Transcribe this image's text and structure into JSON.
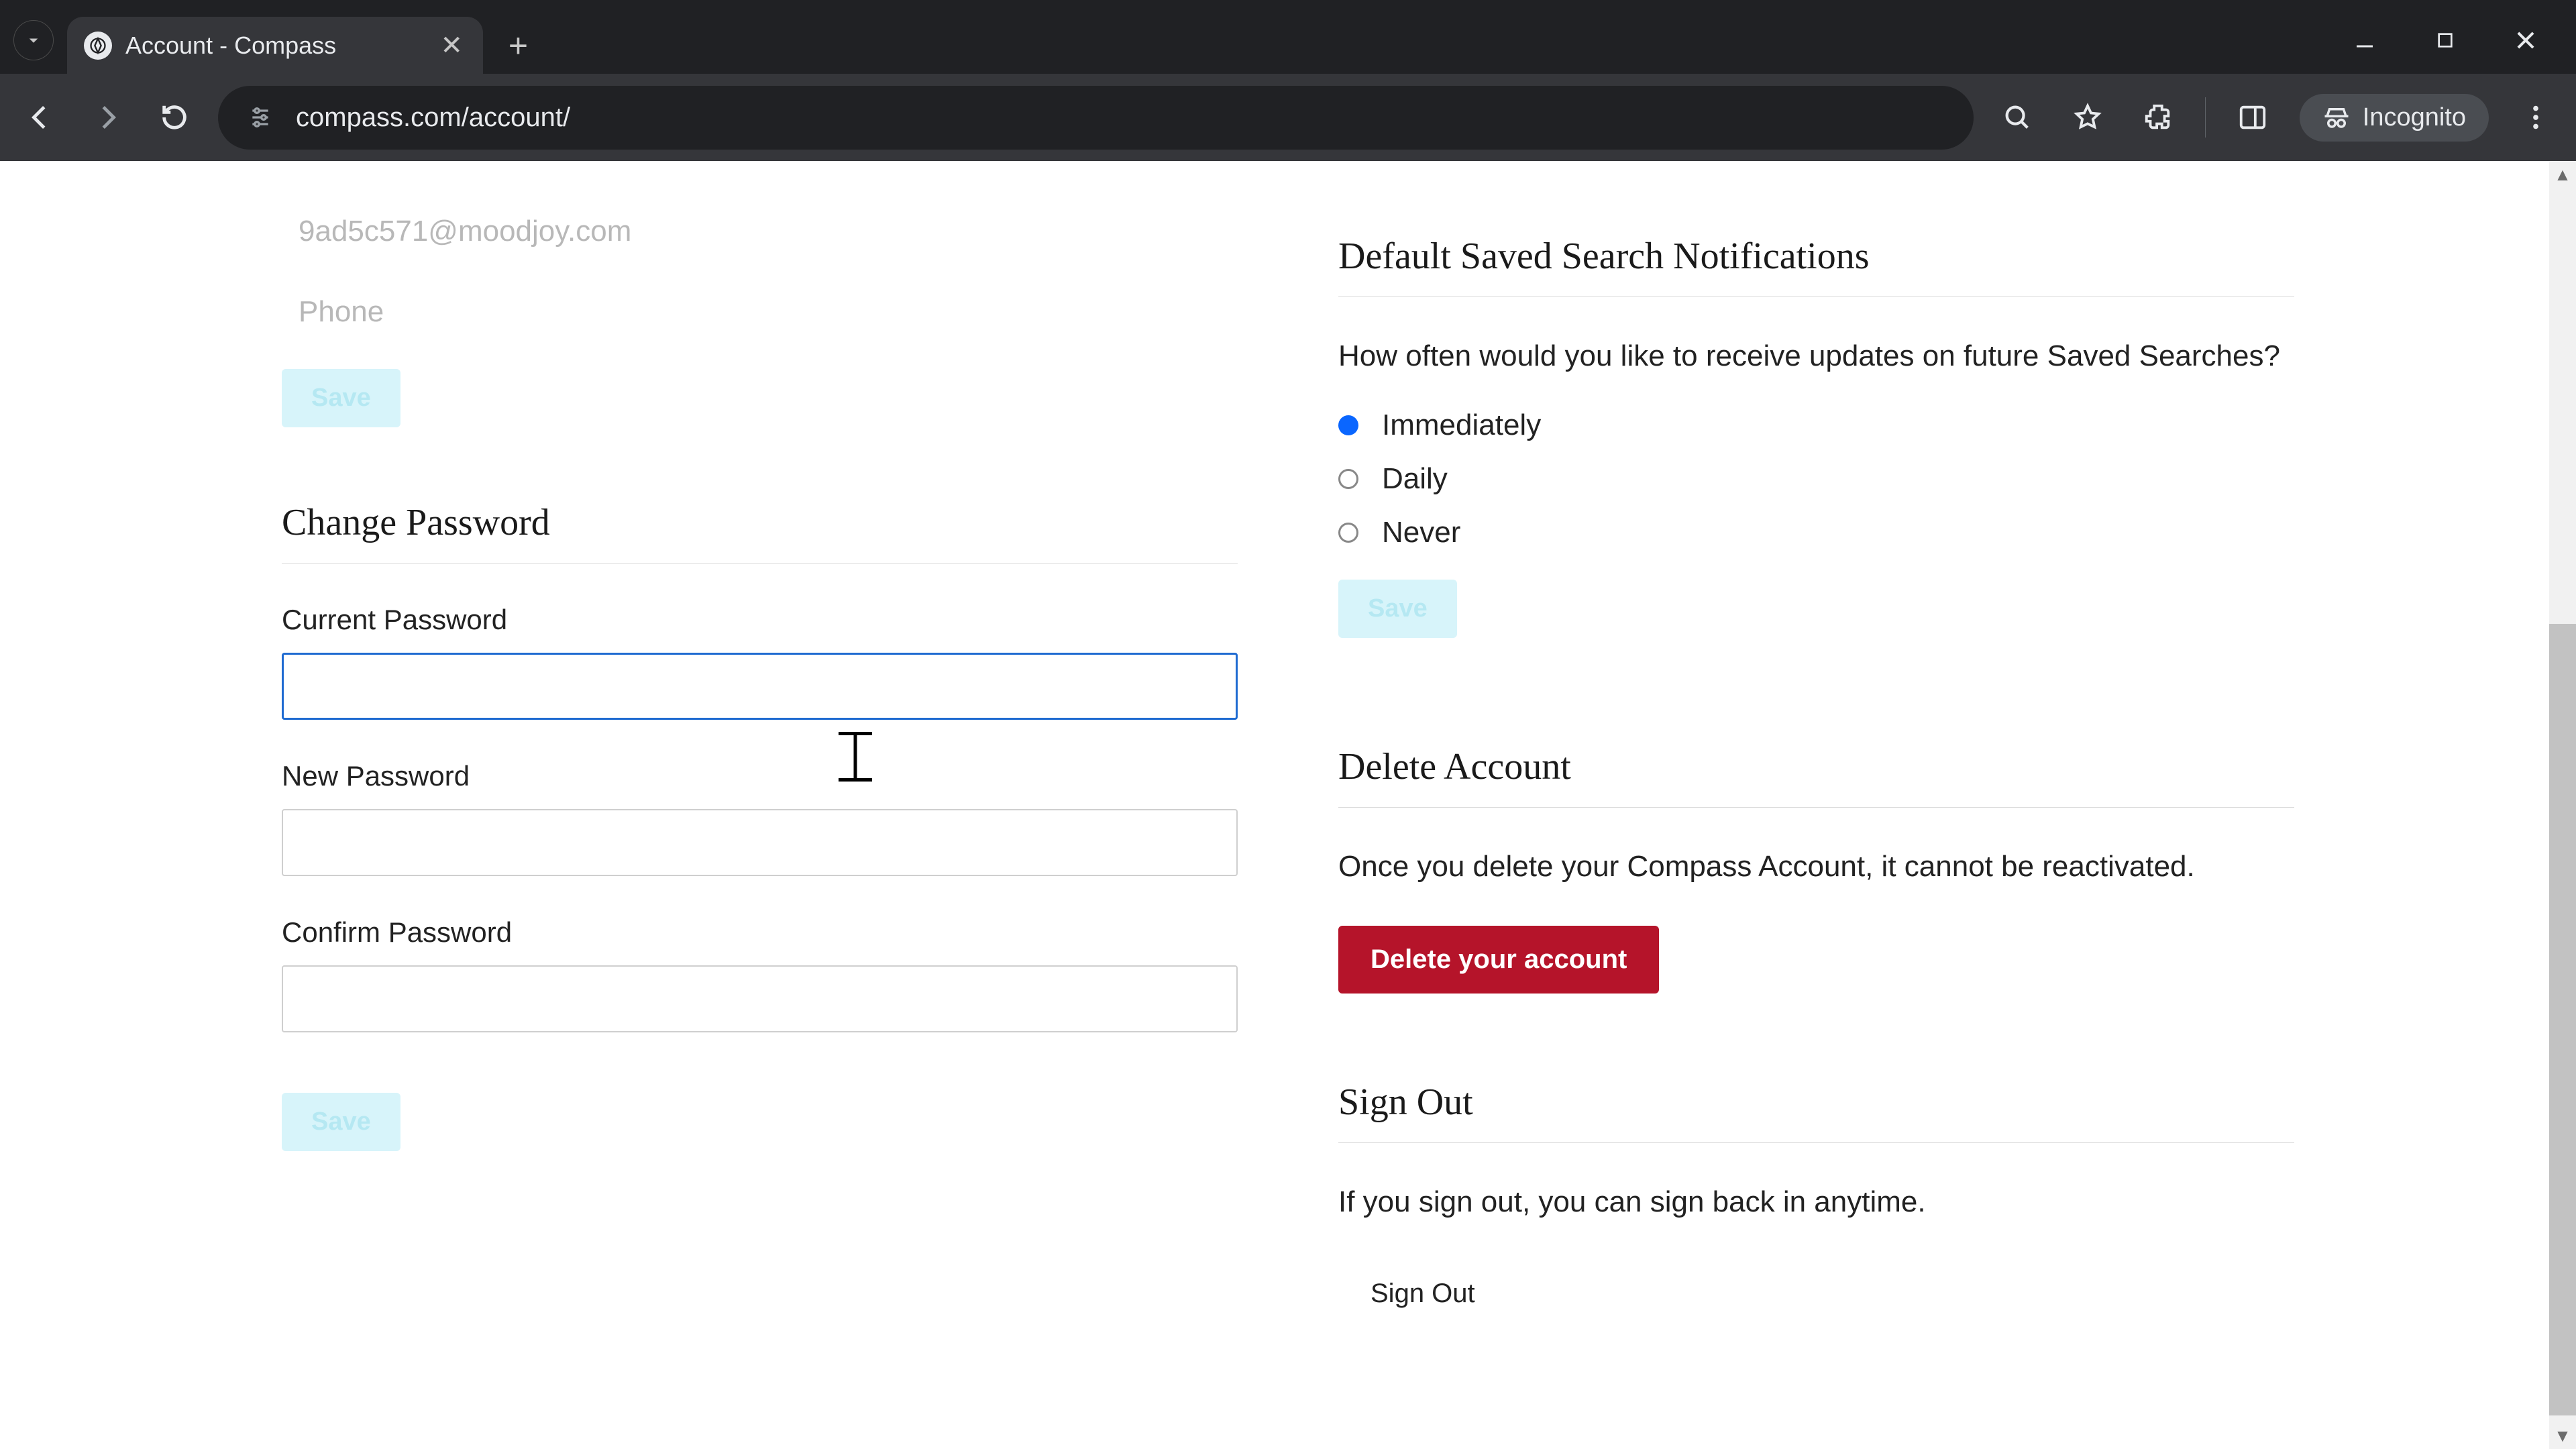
{
  "browser": {
    "tab_title": "Account - Compass",
    "url": "compass.com/account/",
    "incognito_label": "Incognito"
  },
  "left": {
    "email_value": "9ad5c571@moodjoy.com",
    "phone_placeholder": "Phone",
    "save_label": "Save",
    "change_password_heading": "Change Password",
    "current_password_label": "Current Password",
    "new_password_label": "New Password",
    "confirm_password_label": "Confirm Password",
    "save2_label": "Save"
  },
  "right": {
    "notifications_heading": "Default Saved Search Notifications",
    "notifications_desc": "How often would you like to receive updates on future Saved Searches?",
    "options": [
      "Immediately",
      "Daily",
      "Never"
    ],
    "selected_index": 0,
    "save_label": "Save",
    "delete_heading": "Delete Account",
    "delete_desc": "Once you delete your Compass Account, it cannot be reactivated.",
    "delete_button": "Delete your account",
    "signout_heading": "Sign Out",
    "signout_desc": "If you sign out, you can sign back in anytime.",
    "signout_button": "Sign Out"
  }
}
